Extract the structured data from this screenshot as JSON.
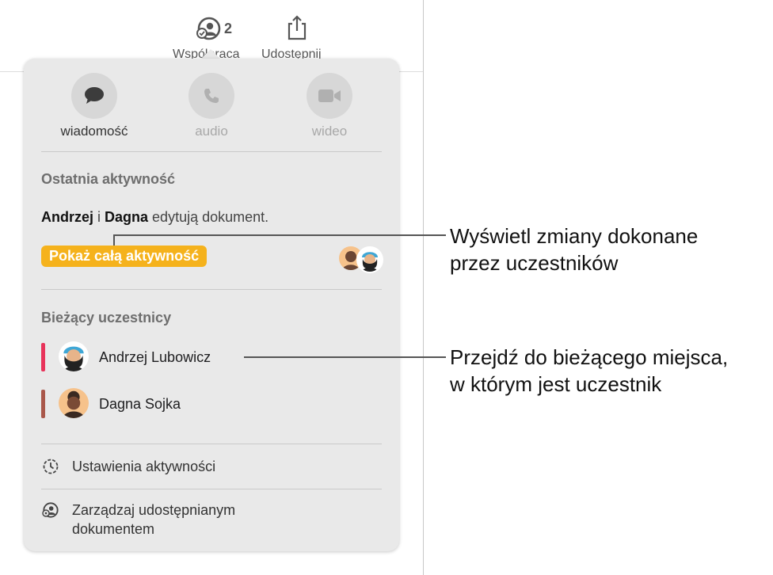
{
  "toolbar": {
    "collaborate_label": "Współpraca",
    "collaborate_count": "2",
    "share_label": "Udostępnij"
  },
  "communication": {
    "message_label": "wiadomość",
    "audio_label": "audio",
    "video_label": "wideo"
  },
  "recent_activity": {
    "title": "Ostatnia aktywność",
    "user1": "Andrzej",
    "conjunction": " i ",
    "user2": "Dagna",
    "action": " edytują dokument.",
    "show_all_label": "Pokaż całą aktywność"
  },
  "participants": {
    "title": "Bieżący uczestnicy",
    "items": [
      {
        "name": "Andrzej Lubowicz",
        "color": "#e8335a"
      },
      {
        "name": "Dagna Sojka",
        "color": "#a9574a"
      }
    ]
  },
  "menu": {
    "activity_settings": "Ustawienia aktywności",
    "manage_line1": "Zarządzaj udostępnianym",
    "manage_line2": "dokumentem"
  },
  "callouts": {
    "top_line1": "Wyświetl zmiany dokonane",
    "top_line2": "przez uczestników",
    "bottom_line1": "Przejdź do bieżącego miejsca,",
    "bottom_line2": "w którym jest uczestnik"
  },
  "colors": {
    "accent": "#f5b21c",
    "popover_bg": "#e9e9e9"
  }
}
